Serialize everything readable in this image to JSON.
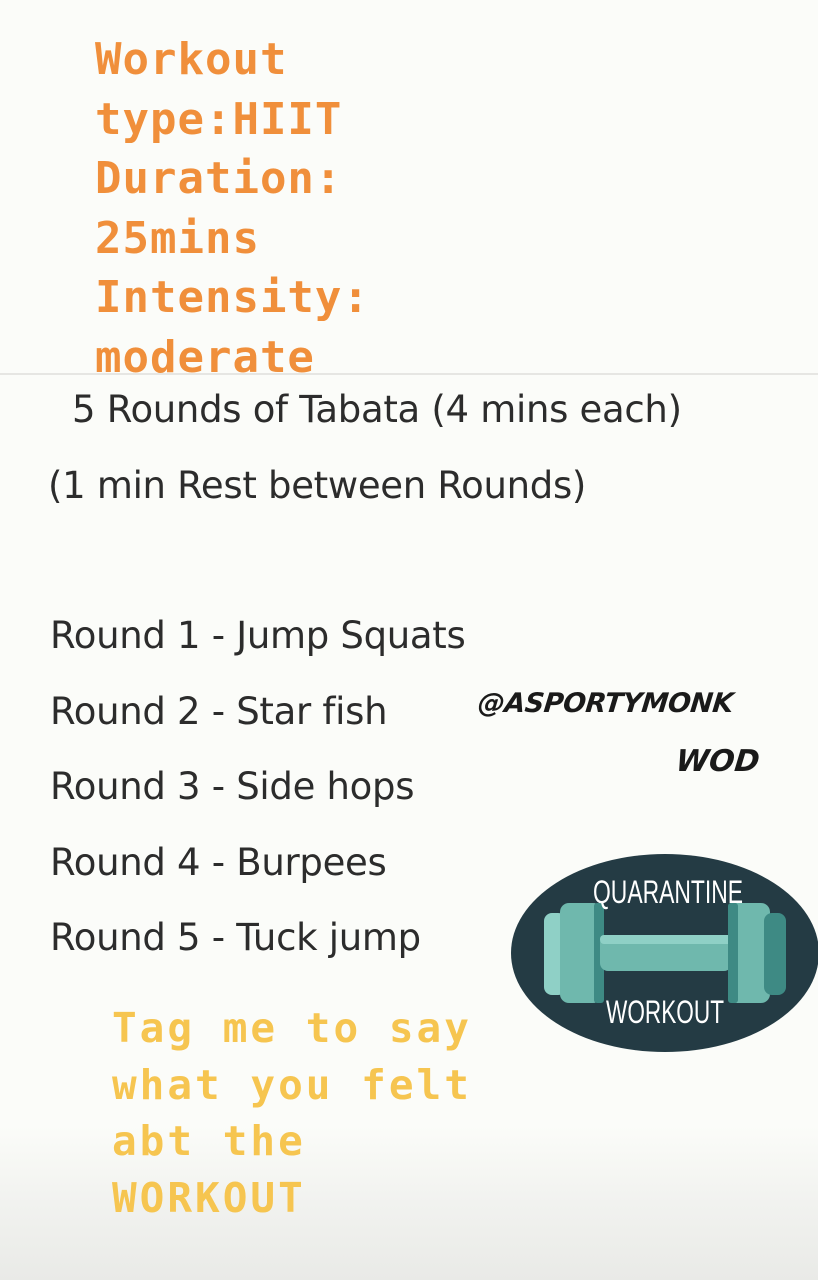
{
  "header": {
    "lines": [
      "Workout",
      "type:HIIT",
      "Duration:",
      "25mins",
      "Intensity:",
      "moderate"
    ]
  },
  "main": {
    "rounds_header": "5 Rounds of Tabata (4 mins each)",
    "rest_note": "(1 min Rest between Rounds)",
    "rounds": [
      "Round 1 - Jump Squats",
      "Round 2 - Star fish",
      "Round 3 - Side hops",
      "Round 4 - Burpees",
      "Round 5 - Tuck jump"
    ]
  },
  "overlay": {
    "handle": "@ASPORTYMONK",
    "tag": "WOD"
  },
  "sticker": {
    "top_text": "QUARANTINE",
    "bottom_text": "WORKOUT",
    "icon": "dumbbell-icon",
    "colors": {
      "background": "#243b44",
      "dumbbell": "#6fb8ad",
      "dumbbell_dark": "#3e8a84",
      "text": "#ffffff"
    }
  },
  "footer": {
    "lines": [
      "Tag me to say",
      "what you felt",
      "abt the",
      "WORKOUT"
    ]
  },
  "colors": {
    "accent_orange": "#f08f3b",
    "accent_yellow": "#f6c550",
    "body_text": "#2c2c2c"
  }
}
